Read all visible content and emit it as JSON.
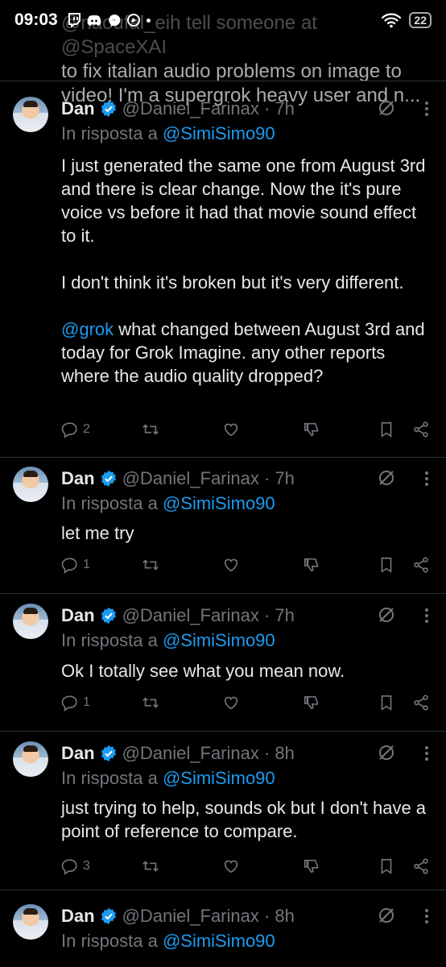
{
  "status_bar": {
    "time": "09:03",
    "battery": "22",
    "left_icons": [
      "twitch-icon",
      "discord-icon",
      "messenger-icon",
      "navigation-icon",
      "dot"
    ],
    "right_icons": [
      "wifi-icon",
      "battery-icon"
    ]
  },
  "previous_tweet": {
    "text_line1": "@naoufal_eih tell someone at @SpaceXAI",
    "text_line2": "to fix italian audio problems on image to",
    "text_line3": "video! I'm a supergrok heavy user and n..."
  },
  "colors": {
    "background": "#000000",
    "text": "#e7e9ea",
    "secondary": "#71767b",
    "link": "#1d9bf0",
    "divider": "#2f3336"
  },
  "tweets": [
    {
      "name": "Dan",
      "handle": "@Daniel_Farinax · 7h",
      "reply_label": "In risposta a ",
      "reply_mention": "@SimiSimo90",
      "p1": "I just generated the same one from August 3rd and there is clear change. Now the it's pure voice vs before it had that movie sound effect to it.",
      "p2": "I don't think it's broken but it's very different.",
      "p3_mention": "@grok",
      "p3": " what changed between August 3rd and today for Grok Imagine. any other reports where the audio quality dropped?",
      "replies": "2"
    },
    {
      "name": "Dan",
      "handle": "@Daniel_Farinax · 7h",
      "reply_label": "In risposta a ",
      "reply_mention": "@SimiSimo90",
      "p1": "let me try",
      "replies": "1"
    },
    {
      "name": "Dan",
      "handle": "@Daniel_Farinax · 7h",
      "reply_label": "In risposta a ",
      "reply_mention": "@SimiSimo90",
      "p1": "Ok I totally see what you mean now.",
      "replies": "1"
    },
    {
      "name": "Dan",
      "handle": "@Daniel_Farinax · 8h",
      "reply_label": "In risposta a ",
      "reply_mention": "@SimiSimo90",
      "p1": "just trying to help, sounds ok but I don't have a point of reference to compare.",
      "replies": "3"
    },
    {
      "name": "Dan",
      "handle": "@Daniel_Farinax · 8h",
      "reply_label": "In risposta a ",
      "reply_mention": "@SimiSimo90"
    }
  ]
}
